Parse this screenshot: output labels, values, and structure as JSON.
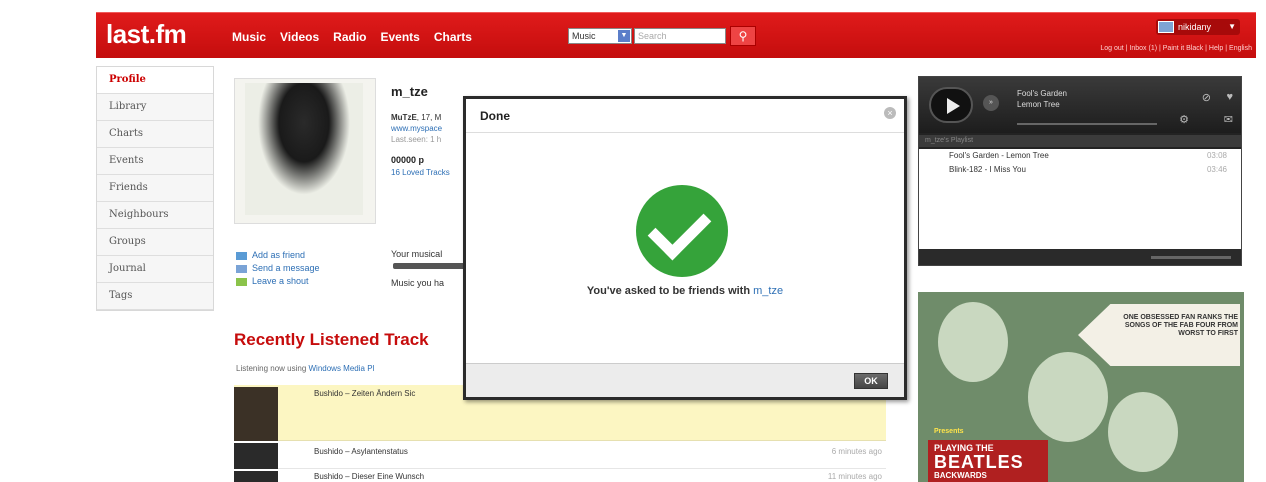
{
  "header": {
    "logo": "last.fm",
    "nav": [
      "Music",
      "Videos",
      "Radio",
      "Events",
      "Charts"
    ],
    "search_select": "Music",
    "search_placeholder": "Search",
    "user": "nikidany",
    "top_links": "Log out | Inbox (1) | Paint it Black | Help | English"
  },
  "sidebar": {
    "items": [
      "Profile",
      "Library",
      "Charts",
      "Events",
      "Friends",
      "Neighbours",
      "Groups",
      "Journal",
      "Tags"
    ]
  },
  "profile": {
    "username": "m_tze",
    "info_name": "MuTzE",
    "info_age": ", 17, M",
    "info_link": "www.myspace",
    "info_last": "Last.seen: 1 h",
    "plays": "00000 p",
    "loved": "16 Loved Tracks",
    "actions": [
      "Add as friend",
      "Send a message",
      "Leave a shout"
    ],
    "compat": "Your musical",
    "compat2": "Music you ha"
  },
  "recent": {
    "title": "Recently Listened Track",
    "listening_prefix": "Listening now using ",
    "listening_link": "Windows Media Pl",
    "tracks": [
      {
        "name": "Bushido – Zeiten Ändern Sic",
        "time": ""
      },
      {
        "name": "Bushido – Asylantenstatus",
        "time": "6 minutes ago"
      },
      {
        "name": "Bushido – Dieser Eine Wunsch",
        "time": "11 minutes ago"
      }
    ]
  },
  "player": {
    "artist": "Fool's Garden",
    "track": "Lemon Tree",
    "playlist_header": "m_tze's Playlist",
    "playlist": [
      {
        "name": "Fool's Garden - Lemon Tree",
        "dur": "03:08"
      },
      {
        "name": "Blink-182 - I Miss You",
        "dur": "03:46"
      }
    ]
  },
  "ad": {
    "arrow_text": "ONE OBSESSED FAN RANKS THE SONGS OF THE FAB FOUR FROM WORST TO FIRST",
    "presents": "Presents",
    "line1": "PLAYING THE",
    "line2": "BEATLES",
    "line3": "BACKWARDS"
  },
  "dialog": {
    "title": "Done",
    "message_prefix": "You've asked to be friends with ",
    "message_user": "m_tze",
    "ok": "OK"
  },
  "colors": {
    "brand_red": "#d11414",
    "success_green": "#35a33a",
    "link_blue": "#2d6fb5"
  }
}
